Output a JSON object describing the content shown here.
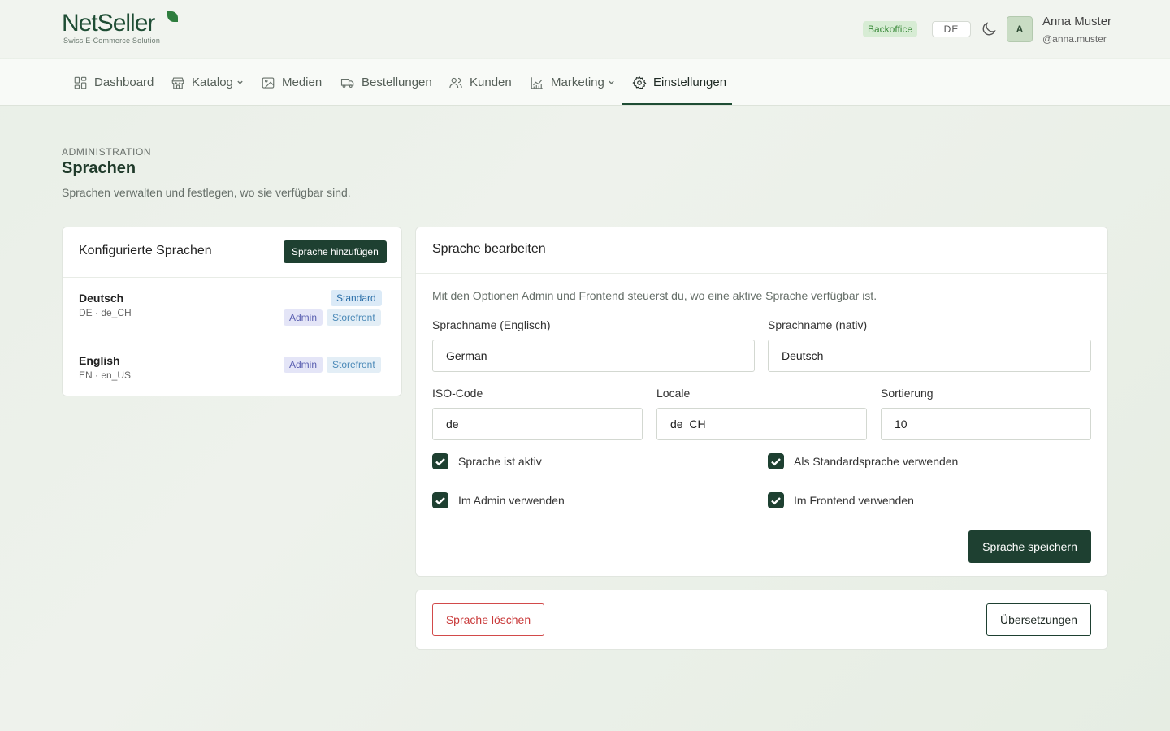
{
  "brand": {
    "name": "NetSeller",
    "tagline": "Swiss E-Commerce Solution"
  },
  "header": {
    "badge": "Backoffice",
    "language": "DE",
    "user_initial": "A",
    "user_name": "Anna Muster",
    "user_handle": "@anna.muster"
  },
  "nav": {
    "items": [
      {
        "label": "Dashboard",
        "icon": "dashboard-icon"
      },
      {
        "label": "Katalog",
        "icon": "store-icon",
        "dropdown": true
      },
      {
        "label": "Medien",
        "icon": "image-icon"
      },
      {
        "label": "Bestellungen",
        "icon": "truck-icon"
      },
      {
        "label": "Kunden",
        "icon": "users-icon"
      },
      {
        "label": "Marketing",
        "icon": "chart-icon",
        "dropdown": true
      },
      {
        "label": "Einstellungen",
        "icon": "gear-icon",
        "active": true
      }
    ]
  },
  "page": {
    "eyebrow": "ADMINISTRATION",
    "title": "Sprachen",
    "description": "Sprachen verwalten und festlegen, wo sie verfügbar sind."
  },
  "languages_panel": {
    "title": "Konfigurierte Sprachen",
    "add_label": "Sprache hinzufügen",
    "items": [
      {
        "name": "Deutsch",
        "meta": "DE · de_CH",
        "standard": "Standard",
        "tags": [
          "Admin",
          "Storefront"
        ]
      },
      {
        "name": "English",
        "meta": "EN · en_US",
        "tags": [
          "Admin",
          "Storefront"
        ]
      }
    ]
  },
  "edit_panel": {
    "title": "Sprache bearbeiten",
    "hint": "Mit den Optionen Admin und Frontend steuerst du, wo eine aktive Sprache verfügbar ist.",
    "fields": {
      "name_en": {
        "label": "Sprachname (Englisch)",
        "value": "German"
      },
      "name_native": {
        "label": "Sprachname (nativ)",
        "value": "Deutsch"
      },
      "iso": {
        "label": "ISO-Code",
        "value": "de"
      },
      "locale": {
        "label": "Locale",
        "value": "de_CH"
      },
      "sort": {
        "label": "Sortierung",
        "value": "10"
      }
    },
    "checkboxes": {
      "active": {
        "label": "Sprache ist aktiv",
        "checked": true
      },
      "default": {
        "label": "Als Standardsprache verwenden",
        "checked": true
      },
      "admin": {
        "label": "Im Admin verwenden",
        "checked": true
      },
      "frontend": {
        "label": "Im Frontend verwenden",
        "checked": true
      }
    },
    "save_label": "Sprache speichern"
  },
  "actions": {
    "delete_label": "Sprache löschen",
    "translations_label": "Übersetzungen"
  },
  "colors": {
    "primary": "#1e4031",
    "danger": "#c93a3a",
    "accent_green": "#3a8a3a"
  }
}
